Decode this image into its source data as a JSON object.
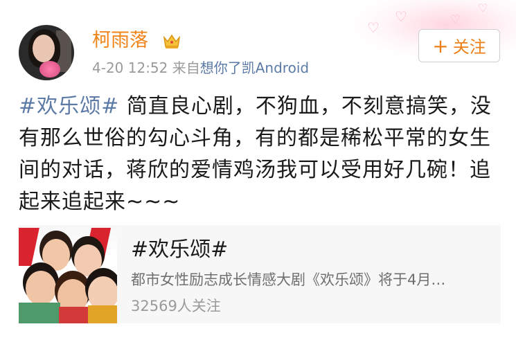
{
  "header": {
    "username": "柯雨落",
    "time": "4-20 12:52",
    "source_prefix": "来自",
    "source_name": "想你了凯Android",
    "follow_icon": "+",
    "follow_label": "关注"
  },
  "post": {
    "hashtag": "#欢乐颂#",
    "text": " 简直良心剧，不狗血，不刻意搞笑，没有那么世俗的勾心斗角，有的都是稀松平常的女生间的对话，蒋欣的爱情鸡汤我可以受用好几碗！追起来追起来~~~"
  },
  "card": {
    "title": "#欢乐颂#",
    "description": "都市女性励志成长情感大剧《欢乐颂》将于4月…",
    "count": "32569人关注"
  },
  "icons": {
    "avatar": "user-avatar",
    "crown": "crown-icon",
    "thumb": "topic-thumbnail"
  },
  "colors": {
    "username": "#f08418",
    "link": "#5b7aa5",
    "follow_text": "#ee7f16",
    "card_bg": "#f7f7f7"
  }
}
